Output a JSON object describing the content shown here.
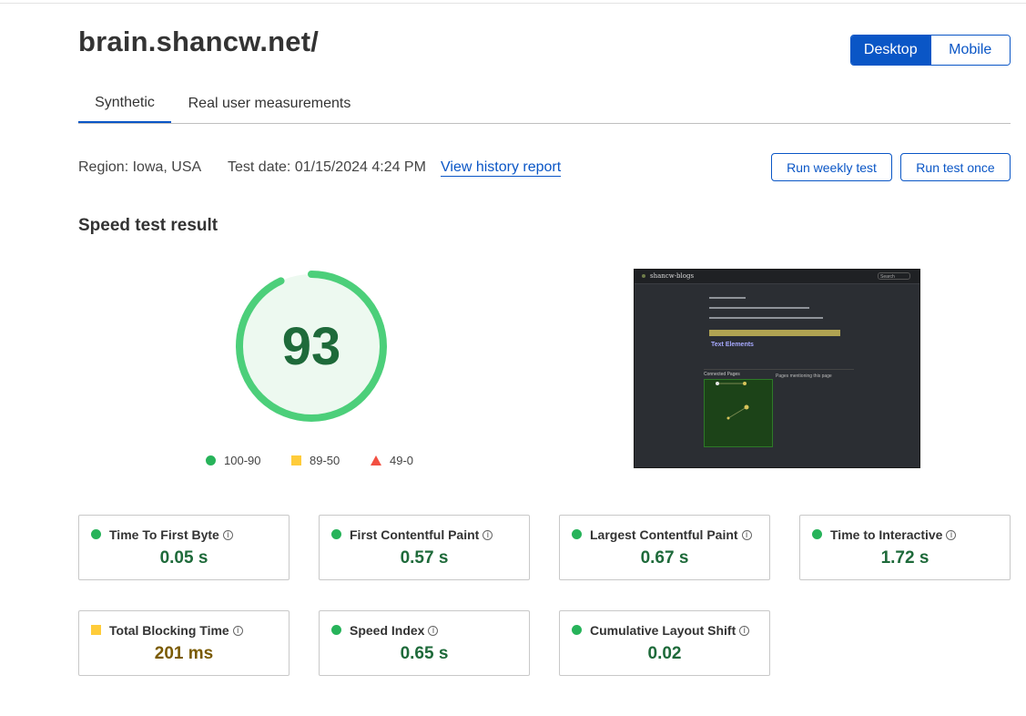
{
  "site": {
    "title": "brain.shancw.net/"
  },
  "device": {
    "desktop": "Desktop",
    "mobile": "Mobile",
    "selected": "Desktop"
  },
  "tabs": [
    {
      "label": "Synthetic",
      "active": true
    },
    {
      "label": "Real user measurements",
      "active": false
    }
  ],
  "meta": {
    "region": "Region: Iowa, USA",
    "test_date": "Test date: 01/15/2024 4:24 PM",
    "history_link": "View history report"
  },
  "actions": {
    "weekly": "Run weekly test",
    "once": "Run test once"
  },
  "result": {
    "title": "Speed test result",
    "score": "93",
    "score_fraction": 0.93,
    "legend": [
      {
        "label": "100-90",
        "color": "#27b35a",
        "shape": "circle"
      },
      {
        "label": "89-50",
        "color": "#ffcc3a",
        "shape": "square"
      },
      {
        "label": "49-0",
        "color": "#f25042",
        "shape": "triangle"
      }
    ]
  },
  "preview": {
    "brand": "shancw-blogs",
    "search": "Search",
    "heading": "Text Elements",
    "connected": "Connected Pages",
    "side": "Pages mentioning this page"
  },
  "metrics": [
    {
      "label": "Time To First Byte",
      "value": "0.05 s",
      "status": "good"
    },
    {
      "label": "First Contentful Paint",
      "value": "0.57 s",
      "status": "good"
    },
    {
      "label": "Largest Contentful Paint",
      "value": "0.67 s",
      "status": "good"
    },
    {
      "label": "Time to Interactive",
      "value": "1.72 s",
      "status": "good"
    },
    {
      "label": "Total Blocking Time",
      "value": "201 ms",
      "status": "warn"
    },
    {
      "label": "Speed Index",
      "value": "0.65 s",
      "status": "good"
    },
    {
      "label": "Cumulative Layout Shift",
      "value": "0.02",
      "status": "good"
    }
  ],
  "colors": {
    "accent": "#0a56c6",
    "good": "#1e6a3a",
    "warn": "#7a5a00",
    "gauge": "#4ccf7a"
  }
}
